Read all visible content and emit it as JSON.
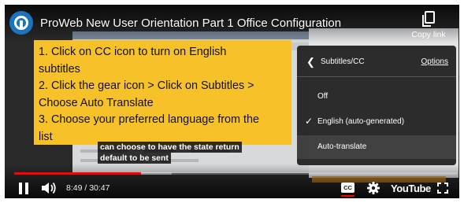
{
  "header": {
    "title": "ProWeb New User Orientation Part 1 Office Configuration",
    "copy_link_label": "Copy link"
  },
  "instructions": {
    "lines": [
      "1. Click on CC icon to turn on English",
      "subtitles",
      "2. Click the gear icon > Click on Subtitles >",
      "Choose Auto Translate",
      "3. Choose your preferred language from the",
      "list"
    ],
    "background": "#f7c12a"
  },
  "caption": {
    "line1": "can choose to have the state return",
    "line2": "default to be sent"
  },
  "settings_menu": {
    "title": "Subtitles/CC",
    "options_link": "Options",
    "items": [
      {
        "label": "Off",
        "selected": false
      },
      {
        "label": "English (auto-generated)",
        "selected": true
      },
      {
        "label": "Auto-translate",
        "selected": false
      }
    ]
  },
  "player": {
    "current_time": "8:49",
    "duration": "30:47",
    "time_separator": " / ",
    "progress_fraction": 0.287,
    "buffered_fraction": 0.355,
    "brand": "YouTube",
    "cc_label": "CC",
    "accent": "#ff0000"
  }
}
